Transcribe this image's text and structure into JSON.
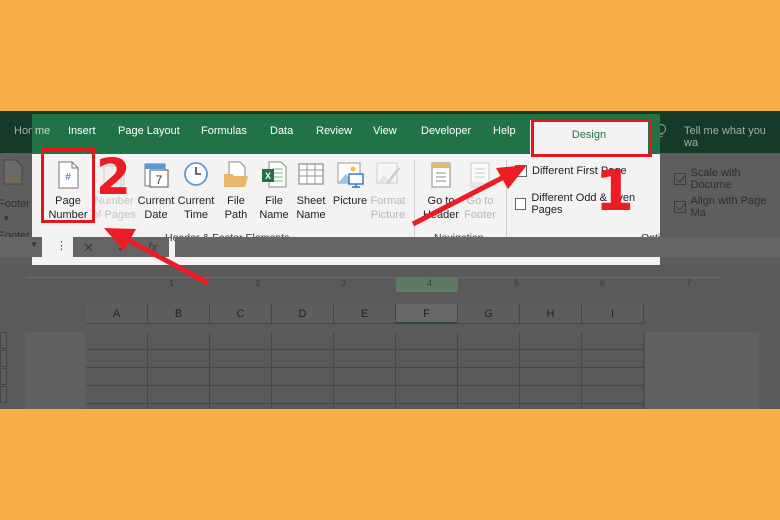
{
  "tabs": {
    "home": "Home",
    "insert": "Insert",
    "page_layout": "Page Layout",
    "formulas": "Formulas",
    "data": "Data",
    "review": "Review",
    "view": "View",
    "developer": "Developer",
    "help": "Help",
    "design": "Design",
    "tell_me": "Tell me what you wa"
  },
  "ribbon": {
    "footer_partial": "Footer",
    "footer_group_partial": "Footer",
    "header_footer_elements": {
      "group_label": "Header & Footer Elements",
      "buttons": [
        {
          "line1": "Page",
          "line2": "Number",
          "icon": "page-number-icon",
          "enabled": true
        },
        {
          "line1": "Number",
          "line2": "of Pages",
          "icon": "number-of-pages-icon",
          "enabled": true
        },
        {
          "line1": "Current",
          "line2": "Date",
          "icon": "calendar-icon",
          "enabled": true
        },
        {
          "line1": "Current",
          "line2": "Time",
          "icon": "clock-icon",
          "enabled": true
        },
        {
          "line1": "File",
          "line2": "Path",
          "icon": "folder-icon",
          "enabled": true
        },
        {
          "line1": "File",
          "line2": "Name",
          "icon": "excel-file-icon",
          "enabled": true
        },
        {
          "line1": "Sheet",
          "line2": "Name",
          "icon": "sheet-grid-icon",
          "enabled": true
        },
        {
          "line1": "Picture",
          "line2": "",
          "icon": "picture-icon",
          "enabled": true
        },
        {
          "line1": "Format",
          "line2": "Picture",
          "icon": "format-picture-icon",
          "enabled": false
        }
      ]
    },
    "navigation": {
      "group_label": "Navigation",
      "buttons": [
        {
          "line1": "Go to",
          "line2": "Header",
          "icon": "go-to-header-icon",
          "enabled": true
        },
        {
          "line1": "Go to",
          "line2": "Footer",
          "icon": "go-to-footer-icon",
          "enabled": false
        }
      ]
    },
    "options": {
      "group_label": "Options",
      "checkboxes": [
        {
          "label": "Different First Page",
          "checked": false
        },
        {
          "label": "Different Odd & Even Pages",
          "checked": false
        },
        {
          "label": "Scale with Docume",
          "checked": true
        },
        {
          "label": "Align with Page Ma",
          "checked": true
        }
      ]
    }
  },
  "formula_bar": {
    "cancel_glyph": "✕",
    "enter_glyph": "✓",
    "fx_glyph": "fx"
  },
  "ruler": {
    "marks": [
      "1",
      "2",
      "3",
      "4",
      "5",
      "6",
      "7"
    ]
  },
  "sheet": {
    "columns": [
      "A",
      "B",
      "C",
      "D",
      "E",
      "F",
      "G",
      "H",
      "I"
    ],
    "selected_column": "F"
  },
  "annotations": {
    "step1": "1",
    "step2": "2"
  },
  "colors": {
    "excel_green": "#217346",
    "annotation_red": "#E8141B",
    "background_orange": "#F6AE45"
  }
}
